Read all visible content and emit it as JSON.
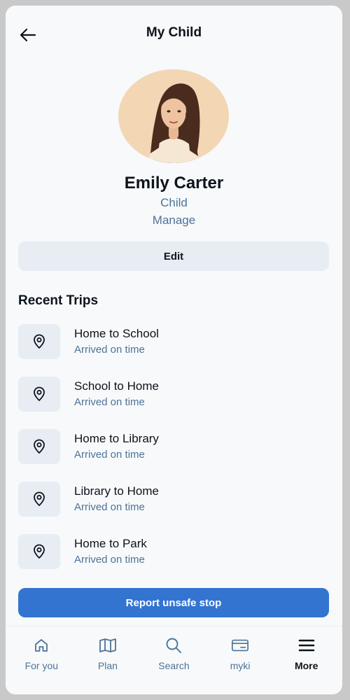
{
  "header": {
    "title": "My Child"
  },
  "profile": {
    "name": "Emily Carter",
    "role": "Child",
    "manage_label": "Manage",
    "edit_label": "Edit"
  },
  "recent_trips": {
    "title": "Recent Trips",
    "items": [
      {
        "title": "Home to School",
        "status": "Arrived on time"
      },
      {
        "title": "School to Home",
        "status": "Arrived on time"
      },
      {
        "title": "Home to Library",
        "status": "Arrived on time"
      },
      {
        "title": "Library to Home",
        "status": "Arrived on time"
      },
      {
        "title": "Home to Park",
        "status": "Arrived on time"
      }
    ]
  },
  "report_button": {
    "label": "Report unsafe stop"
  },
  "nav": {
    "items": [
      {
        "label": "For you",
        "icon": "home-icon"
      },
      {
        "label": "Plan",
        "icon": "map-icon"
      },
      {
        "label": "Search",
        "icon": "search-icon"
      },
      {
        "label": "myki",
        "icon": "card-icon"
      },
      {
        "label": "More",
        "icon": "menu-icon",
        "active": true
      }
    ]
  },
  "colors": {
    "primary_text": "#0e141b",
    "secondary_text": "#4e7397",
    "surface": "#e7edf3",
    "accent": "#3374d1",
    "background": "#f7f9fb"
  }
}
